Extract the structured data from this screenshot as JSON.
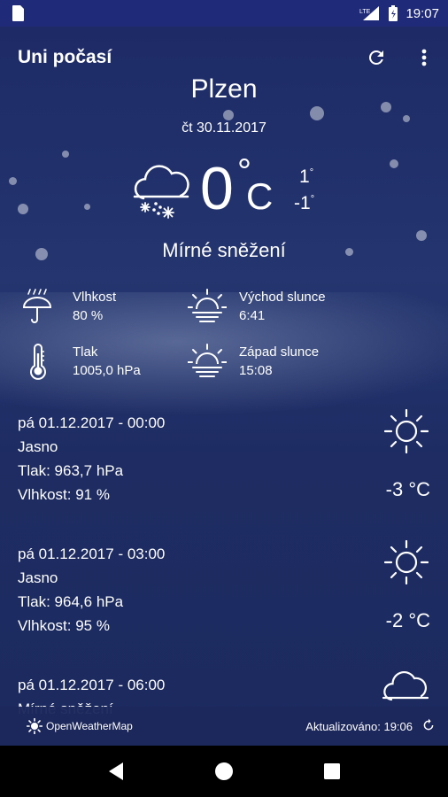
{
  "status_bar": {
    "time": "19:07",
    "network": "LTE"
  },
  "toolbar": {
    "title": "Uni počasí",
    "refresh_icon": "refresh-icon",
    "menu_icon": "more-vert-icon"
  },
  "current": {
    "city": "Plzen",
    "date": "čt 30.11.2017",
    "temp": "0",
    "unit": "C",
    "high": "1",
    "low": "-1",
    "description": "Mírné sněžení",
    "icon": "snow-cloud-icon"
  },
  "details": {
    "humidity_label": "Vlhkost",
    "humidity_value": "80 %",
    "sunrise_label": "Východ slunce",
    "sunrise_value": "6:41",
    "pressure_label": "Tlak",
    "pressure_value": "1005,0 hPa",
    "sunset_label": "Západ slunce",
    "sunset_value": "15:08"
  },
  "forecast": [
    {
      "datetime": "pá 01.12.2017 - 00:00",
      "condition": "Jasno",
      "pressure": "Tlak: 963,7 hPa",
      "humidity": "Vlhkost: 91 %",
      "temp": "-3 °C",
      "icon": "sun-icon"
    },
    {
      "datetime": "pá 01.12.2017 - 03:00",
      "condition": "Jasno",
      "pressure": "Tlak: 964,6 hPa",
      "humidity": "Vlhkost: 95 %",
      "temp": "-2 °C",
      "icon": "sun-icon"
    },
    {
      "datetime": "pá 01.12.2017 - 06:00",
      "condition": "Mírné sněžení",
      "pressure": "",
      "humidity": "",
      "temp": "",
      "icon": "snow-cloud-icon"
    }
  ],
  "footer": {
    "provider": "OpenWeatherMap",
    "updated": "Aktualizováno: 19:06"
  },
  "colors": {
    "background": "#1e2c66",
    "status_bar": "#1f2a78"
  }
}
